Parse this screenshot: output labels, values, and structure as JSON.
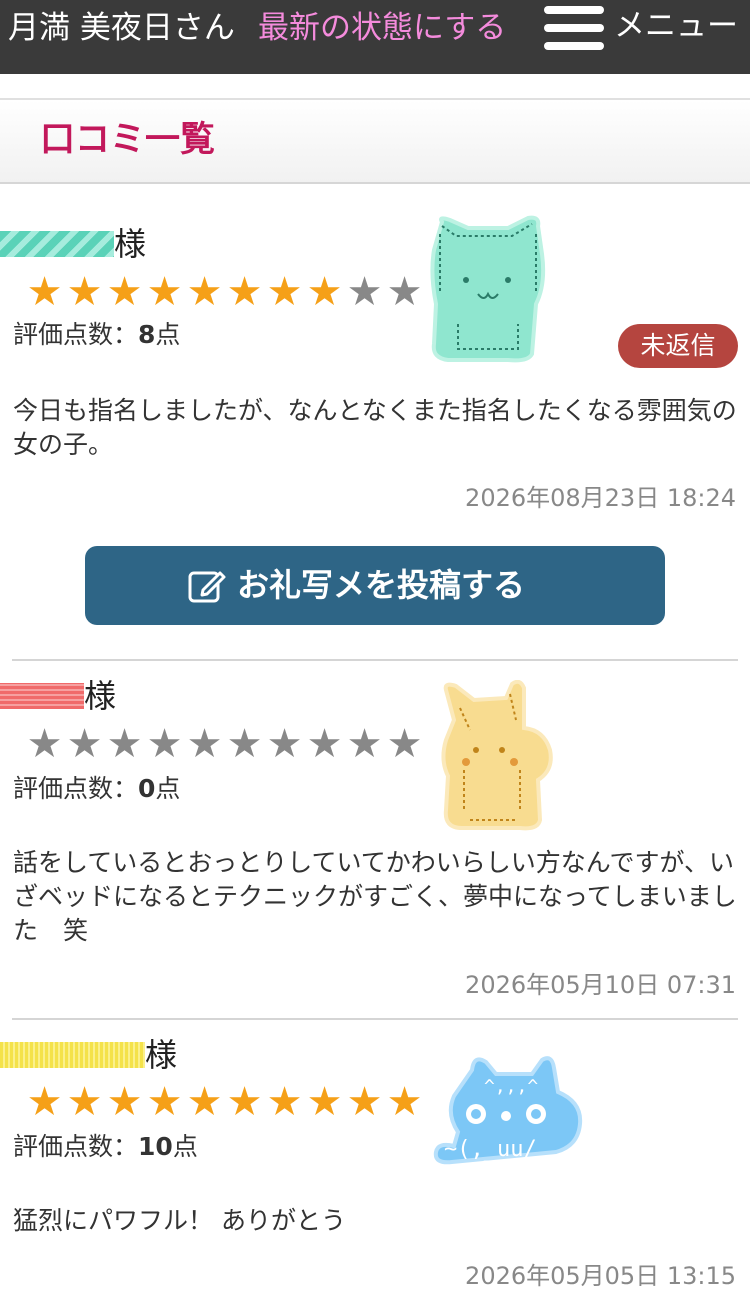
{
  "header": {
    "cast_name": "月満 美夜日さん",
    "refresh_label": "最新の状態にする",
    "menu_label": "メニュー"
  },
  "section": {
    "title": "口コミ一覧"
  },
  "colors": {
    "accent": "#c2185b",
    "button": "#2e6586",
    "star_on": "#f5a018",
    "star_off": "#888888",
    "badge": "#b5453f"
  },
  "reviews": [
    {
      "suffix": "様",
      "rating": 8,
      "max_rating": 10,
      "score_label": "評価点数：",
      "score_value": "8",
      "score_unit": "点",
      "badge": "未返信",
      "text": "今日も指名しましたが、なんとなくまた指名したくなる雰囲気の女の子。",
      "date": "2026年08月23日 18:24",
      "avatar": "cat-ascii-green-icon"
    },
    {
      "suffix": "様",
      "rating": 0,
      "max_rating": 10,
      "score_label": "評価点数：",
      "score_value": "0",
      "score_unit": "点",
      "text": "話をしているとおっとりしていてかわいらしい方なんですが、いざベッドになるとテクニックがすごく、夢中になってしまいました　笑",
      "date": "2026年05月10日 07:31",
      "avatar": "pikachu-ascii-yellow-icon"
    },
    {
      "suffix": "様",
      "rating": 10,
      "max_rating": 10,
      "score_label": "評価点数：",
      "score_value": "10",
      "score_unit": "点",
      "text": "猛烈にパワフル！ ありがとう",
      "date": "2026年05月05日 13:15",
      "avatar": "cat-ascii-blue-icon"
    }
  ],
  "post_button": {
    "label": "お礼写メを投稿する",
    "icon": "edit-icon"
  }
}
